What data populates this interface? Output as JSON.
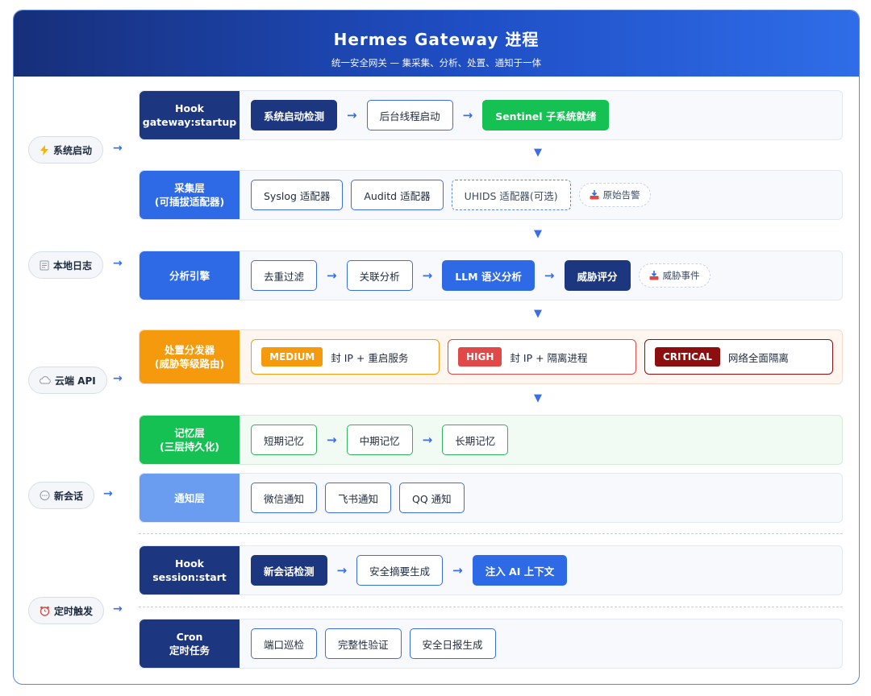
{
  "header": {
    "title": "Hermes Gateway 进程",
    "subtitle": "统一安全网关 — 集采集、分析、处置、通知于一体"
  },
  "triggers": [
    {
      "label": "系统启动",
      "icon": "lightning-icon"
    },
    {
      "label": "本地日志",
      "icon": "notepad-icon"
    },
    {
      "label": "云端 API",
      "icon": "cloud-icon"
    },
    {
      "label": "新会话",
      "icon": "speech-bubble-icon"
    },
    {
      "label": "定时触发",
      "icon": "alarm-clock-icon"
    }
  ],
  "hook_startup": {
    "label_line1": "Hook",
    "label_line2": "gateway:startup",
    "nodes": [
      "系统启动检测",
      "后台线程启动",
      "Sentinel 子系统就绪"
    ]
  },
  "collect": {
    "label_line1": "采集层",
    "label_line2": "(可插拔适配器)",
    "nodes": [
      "Syslog 适配器",
      "Auditd 适配器",
      "UHIDS 适配器(可选)"
    ],
    "tag": "原始告警"
  },
  "analysis": {
    "label": "分析引擎",
    "nodes": [
      "去重过滤",
      "关联分析",
      "LLM 语义分析",
      "威胁评分"
    ],
    "tag": "威胁事件"
  },
  "dispatch": {
    "label_line1": "处置分发器",
    "label_line2": "(威胁等级路由)",
    "levels": [
      {
        "badge": "MEDIUM",
        "text": "封 IP + 重启服务"
      },
      {
        "badge": "HIGH",
        "text": "封 IP + 隔离进程"
      },
      {
        "badge": "CRITICAL",
        "text": "网络全面隔离"
      }
    ]
  },
  "memory": {
    "label_line1": "记忆层",
    "label_line2": "(三层持久化)",
    "nodes": [
      "短期记忆",
      "中期记忆",
      "长期记忆"
    ]
  },
  "notify": {
    "label": "通知层",
    "nodes": [
      "微信通知",
      "飞书通知",
      "QQ 通知"
    ]
  },
  "hook_session": {
    "label_line1": "Hook",
    "label_line2": "session:start",
    "nodes": [
      "新会话检测",
      "安全摘要生成",
      "注入 AI 上下文"
    ]
  },
  "cron": {
    "label_line1": "Cron",
    "label_line2": "定时任务",
    "nodes": [
      "端口巡检",
      "完整性验证",
      "安全日报生成"
    ]
  },
  "colors": {
    "navy": "#1d3680",
    "blue": "#2f6ae6",
    "orange": "#f59a0d",
    "green": "#16c153",
    "red": "#e14848",
    "dark_red": "#8d0e0e"
  }
}
